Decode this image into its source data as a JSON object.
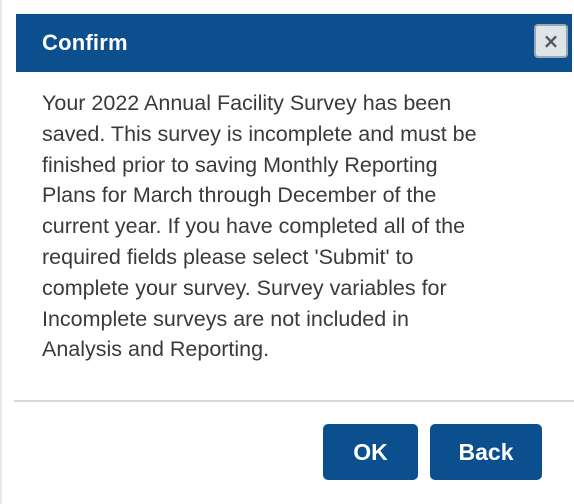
{
  "dialog": {
    "title": "Confirm",
    "close_icon": "close-icon",
    "message_lines": [
      "Your 2022 Annual Facility Survey has been",
      "saved. This survey is incomplete and must be",
      "finished prior to saving Monthly Reporting",
      "Plans for March through December of the",
      "current year. If you have completed all of the",
      "required fields please select 'Submit' to",
      "complete your survey. Survey variables for",
      "Incomplete surveys are not included in",
      "Analysis and Reporting."
    ],
    "ok_label": "OK",
    "back_label": "Back"
  },
  "colors": {
    "header_background": "#0b4f8f",
    "button_background": "#0b4f8f",
    "text": "#3a3a3a"
  }
}
